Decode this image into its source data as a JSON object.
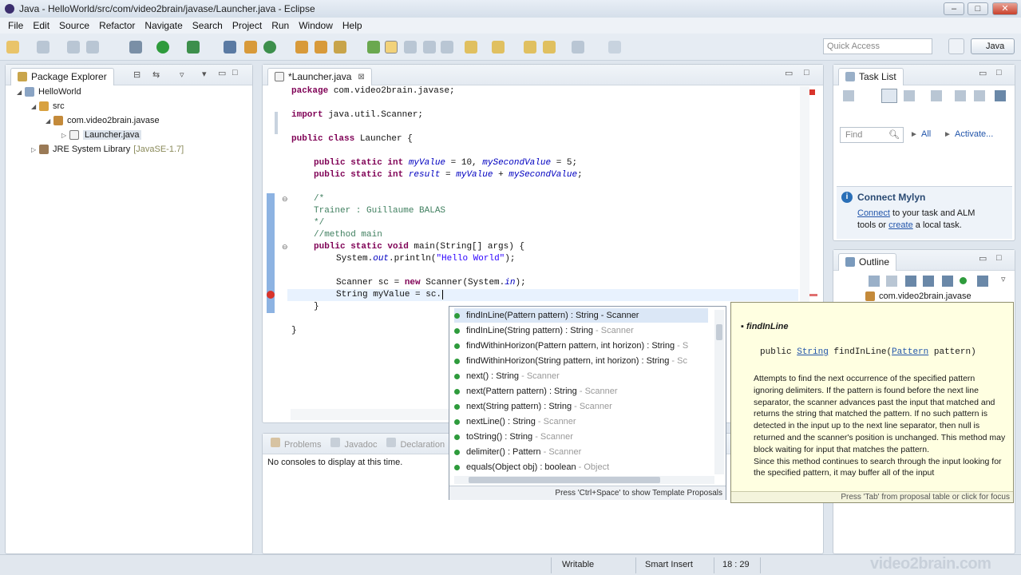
{
  "window": {
    "title": "Java - HelloWorld/src/com/video2brain/javase/Launcher.java - Eclipse"
  },
  "menu": [
    "File",
    "Edit",
    "Source",
    "Refactor",
    "Navigate",
    "Search",
    "Project",
    "Run",
    "Window",
    "Help"
  ],
  "quick_access": {
    "placeholder": "Quick Access"
  },
  "perspective": {
    "label": "Java"
  },
  "package_explorer": {
    "title": "Package Explorer",
    "project": "HelloWorld",
    "src": "src",
    "package": "com.video2brain.javase",
    "file": "Launcher.java",
    "jre": "JRE System Library",
    "jre_version": "[JavaSE-1.7]"
  },
  "editor": {
    "tab": "*Launcher.java",
    "lines": {
      "l1_kw": "package",
      "l1": " com.video2brain.javase;",
      "l2_kw": "import",
      "l2": " java.util.Scanner;",
      "l3_kw": "public class",
      "l3": " Launcher {",
      "l4_kw": "public static int",
      "l4_f1": "myValue",
      "l4_a": " = 10, ",
      "l4_f2": "mySecondValue",
      "l4_b": " = 5;",
      "l5_kw": "public static int",
      "l5_f1": "result",
      "l5_a": " = ",
      "l5_f2": "myValue",
      "l5_b": " + ",
      "l5_f3": "mySecondValue",
      "l5_c": ";",
      "c1": "/*",
      "c2": "Trainer : Guillaume BALAS",
      "c3": "*/",
      "c4": "//method main",
      "l6_kw": "public static void",
      "l6": " main(String[] args) {",
      "l7_a": "System.",
      "l7_f": "out",
      "l7_b": ".println(",
      "l7_s": "\"Hello World\"",
      "l7_c": ");",
      "l8_a": "Scanner sc = ",
      "l8_kw": "new",
      "l8_b": " Scanner(System.",
      "l8_f": "in",
      "l8_c": ");",
      "l9": "String myValue = sc.",
      "l10": "}",
      "l11": "}"
    }
  },
  "console": {
    "tabs": [
      "Problems",
      "Javadoc",
      "Declaration"
    ],
    "message": "No consoles to display at this time."
  },
  "proposals": {
    "items": [
      {
        "sig": "findInLine(Pattern pattern) : String",
        "owner": "Scanner"
      },
      {
        "sig": "findInLine(String pattern) : String",
        "owner": "Scanner"
      },
      {
        "sig": "findWithinHorizon(Pattern pattern, int horizon) : String",
        "owner": "S"
      },
      {
        "sig": "findWithinHorizon(String pattern, int horizon) : String",
        "owner": "Sc"
      },
      {
        "sig": "next() : String",
        "owner": "Scanner"
      },
      {
        "sig": "next(Pattern pattern) : String",
        "owner": "Scanner"
      },
      {
        "sig": "next(String pattern) : String",
        "owner": "Scanner"
      },
      {
        "sig": "nextLine() : String",
        "owner": "Scanner"
      },
      {
        "sig": "toString() : String",
        "owner": "Scanner"
      },
      {
        "sig": "delimiter() : Pattern",
        "owner": "Scanner"
      },
      {
        "sig": "equals(Object obj) : boolean",
        "owner": "Object"
      }
    ],
    "footer": "Press 'Ctrl+Space' to show Template Proposals"
  },
  "javadoc": {
    "name": "findInLine",
    "sig_a": "public ",
    "sig_type": "String",
    "sig_b": " findInLine(",
    "sig_param": "Pattern",
    "sig_c": " pattern)",
    "body": "Attempts to find the next occurrence of the specified pattern ignoring delimiters. If the pattern is found before the next line separator, the scanner advances past the input that matched and returns the string that matched the pattern. If no such pattern is detected in the input up to the next line separator, then null is returned and the scanner's position is unchanged. This method may block waiting for input that matches the pattern.",
    "body2": "Since this method continues to search through the input looking for the specified pattern, it may buffer all of the input",
    "footer": "Press 'Tab' from proposal table or click for focus"
  },
  "task_list": {
    "title": "Task List",
    "find_placeholder": "Find",
    "all": "All",
    "activate": "Activate..."
  },
  "mylyn": {
    "title": "Connect Mylyn",
    "connect": "Connect",
    "t1": " to your task and ALM",
    "t2": "tools or ",
    "create": "create",
    "t3": " a local task."
  },
  "outline": {
    "title": "Outline",
    "item": "com.video2brain.javase"
  },
  "status": {
    "writable": "Writable",
    "insert": "Smart Insert",
    "pos": "18 : 29"
  },
  "watermark": "video2brain.com"
}
